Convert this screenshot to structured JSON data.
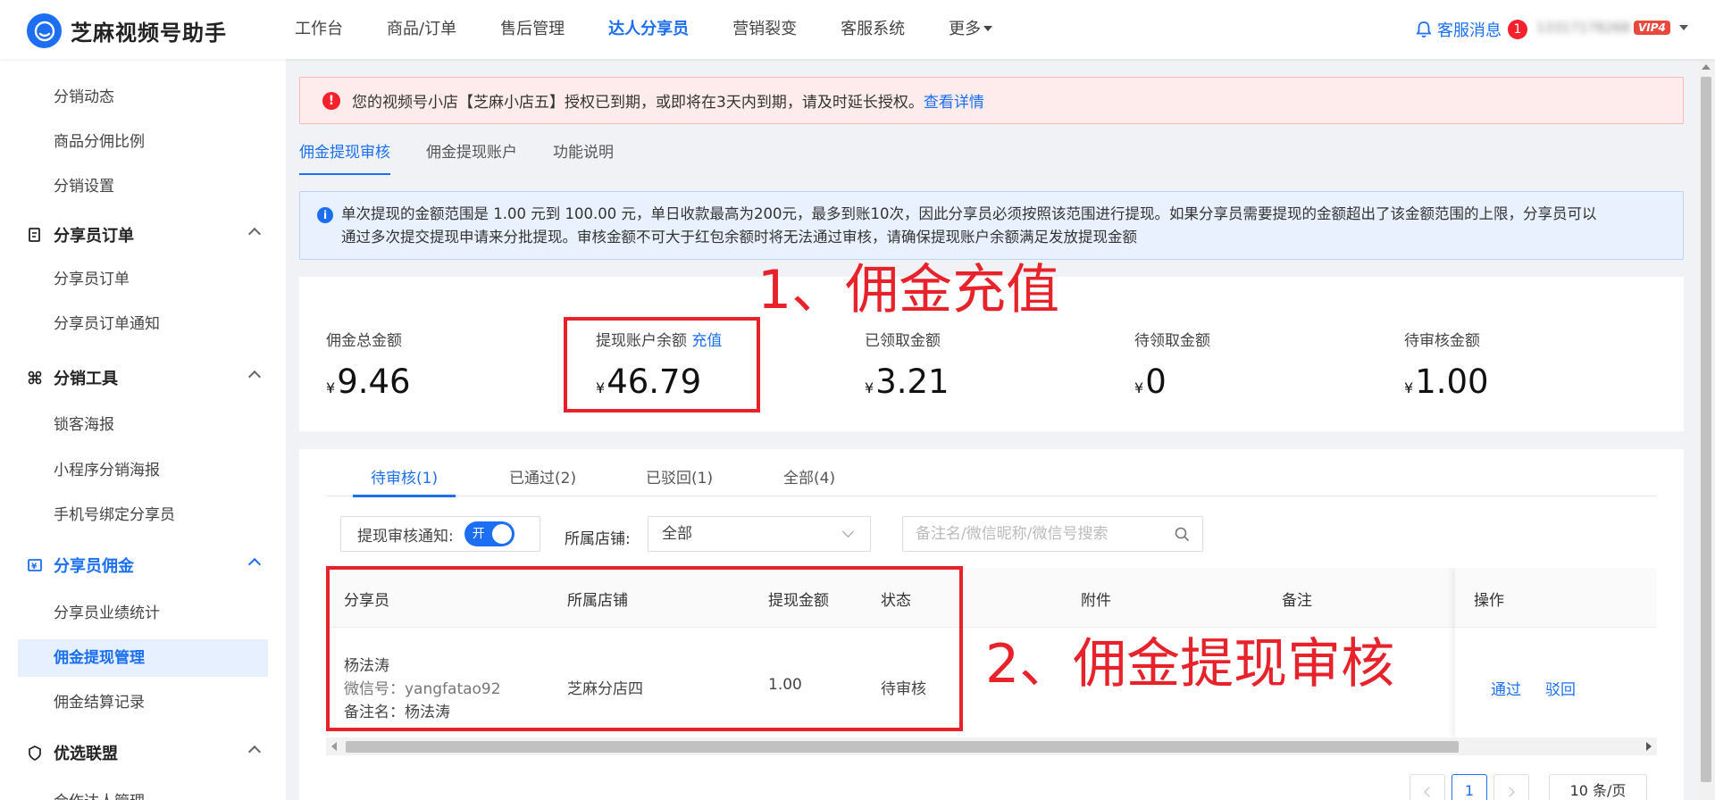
{
  "app": {
    "name": "芝麻视频号助手",
    "nav": [
      "工作台",
      "商品/订单",
      "售后管理",
      "达人分享员",
      "营销裂变",
      "客服系统",
      "更多"
    ],
    "active_nav": "达人分享员",
    "message_label": "客服消息",
    "message_count": "1",
    "account_phone": "13317178268",
    "vip_label": "VIP4"
  },
  "sidebar": {
    "items": [
      {
        "label": "分销动态",
        "type": "item"
      },
      {
        "label": "商品分佣比例",
        "type": "item"
      },
      {
        "label": "分销设置",
        "type": "item"
      },
      {
        "label": "分享员订单",
        "type": "group"
      },
      {
        "label": "分享员订单",
        "type": "item"
      },
      {
        "label": "分享员订单通知",
        "type": "item"
      },
      {
        "label": "分销工具",
        "type": "group"
      },
      {
        "label": "锁客海报",
        "type": "item"
      },
      {
        "label": "小程序分销海报",
        "type": "item"
      },
      {
        "label": "手机号绑定分享员",
        "type": "item"
      },
      {
        "label": "分享员佣金",
        "type": "group",
        "active": true
      },
      {
        "label": "分享员业绩统计",
        "type": "item"
      },
      {
        "label": "佣金提现管理",
        "type": "item",
        "active": true
      },
      {
        "label": "佣金结算记录",
        "type": "item"
      },
      {
        "label": "优选联盟",
        "type": "group"
      },
      {
        "label": "合作达人管理",
        "type": "item"
      }
    ]
  },
  "alert": {
    "text": "您的视频号小店【芝麻小店五】授权已到期，或即将在3天内到期，请及时延长授权。",
    "link": "查看详情"
  },
  "subtabs": [
    "佣金提现审核",
    "佣金提现账户",
    "功能说明"
  ],
  "info": {
    "line1": "单次提现的金额范围是 1.00 元到 100.00 元，单日收款最高为200元，最多到账10次，因此分享员必须按照该范围进行提现。如果分享员需要提现的金额超出了该金额范围的上限，分享员可以",
    "line2": "通过多次提交提现申请来分批提现。审核金额不可大于红包余额时将无法通过审核，请确保提现账户余额满足发放提现金额"
  },
  "stats": [
    {
      "label": "佣金总金额",
      "link": "",
      "currency": "¥",
      "value": "9.46"
    },
    {
      "label": "提现账户余额",
      "link": "充值",
      "currency": "¥",
      "value": "46.79"
    },
    {
      "label": "已领取金额",
      "link": "",
      "currency": "¥",
      "value": "3.21"
    },
    {
      "label": "待领取金额",
      "link": "",
      "currency": "¥",
      "value": "0"
    },
    {
      "label": "待审核金额",
      "link": "",
      "currency": "¥",
      "value": "1.00"
    }
  ],
  "annotations": {
    "a1": "1、佣金充值",
    "a2": "2、佣金提现审核"
  },
  "review_tabs": [
    "待审核(1)",
    "已通过(2)",
    "已驳回(1)",
    "全部(4)"
  ],
  "filters": {
    "notify_label": "提现审核通知:",
    "toggle_text": "开",
    "store_label": "所属店铺:",
    "store_value": "全部",
    "search_placeholder": "备注名/微信昵称/微信号搜索"
  },
  "table": {
    "headers": [
      "分享员",
      "所属店铺",
      "提现金额",
      "状态",
      "附件",
      "备注",
      "操作"
    ],
    "rows": [
      {
        "name": "杨法涛",
        "wechat": "微信号：yangfatao92",
        "remark": "备注名：杨法涛",
        "store": "芝麻分店四",
        "amount": "1.00",
        "status": "待审核",
        "actions": [
          "通过",
          "驳回"
        ]
      }
    ]
  },
  "pagination": {
    "current": "1",
    "page_size": "10 条/页"
  }
}
